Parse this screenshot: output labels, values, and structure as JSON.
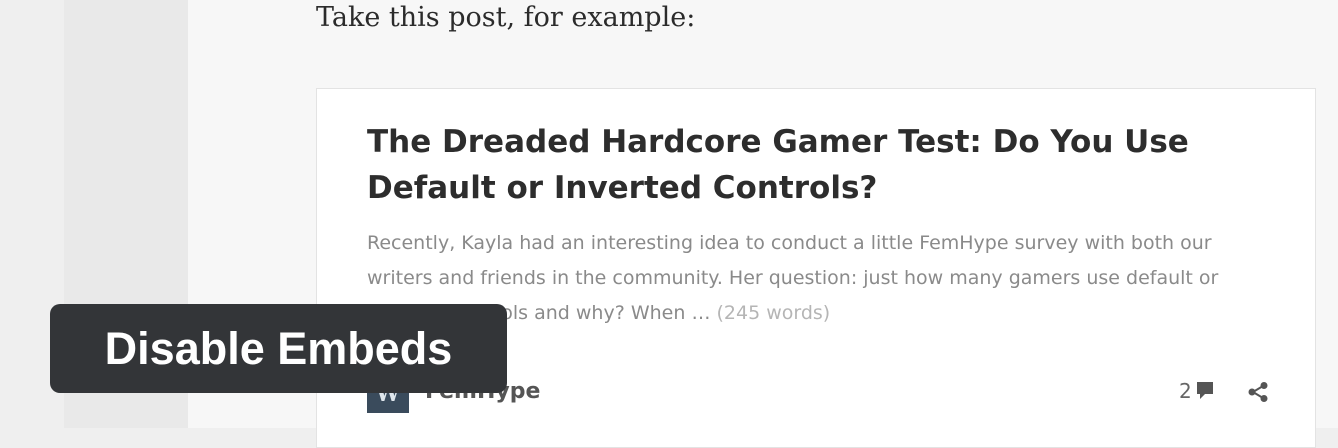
{
  "intro_text": "Take this post, for example:",
  "embed": {
    "title": "The Dreaded Hardcore Gamer Test: Do You Use Default or Inverted Controls?",
    "excerpt": "Recently, Kayla had an interesting idea to conduct a little FemHype survey with both our writers and friends in the community. Her question: just how many gamers use default or inverted controls and why? When … ",
    "word_count": "(245 words)",
    "site_name": "FemHype",
    "comment_count": "2",
    "icons": {
      "site": "wordpress-icon",
      "comment": "comment-icon",
      "share": "share-icon"
    }
  },
  "badge": {
    "label": "Disable Embeds"
  },
  "colors": {
    "badge_bg": "#333538",
    "site_icon_bg": "#3a4b5c"
  }
}
